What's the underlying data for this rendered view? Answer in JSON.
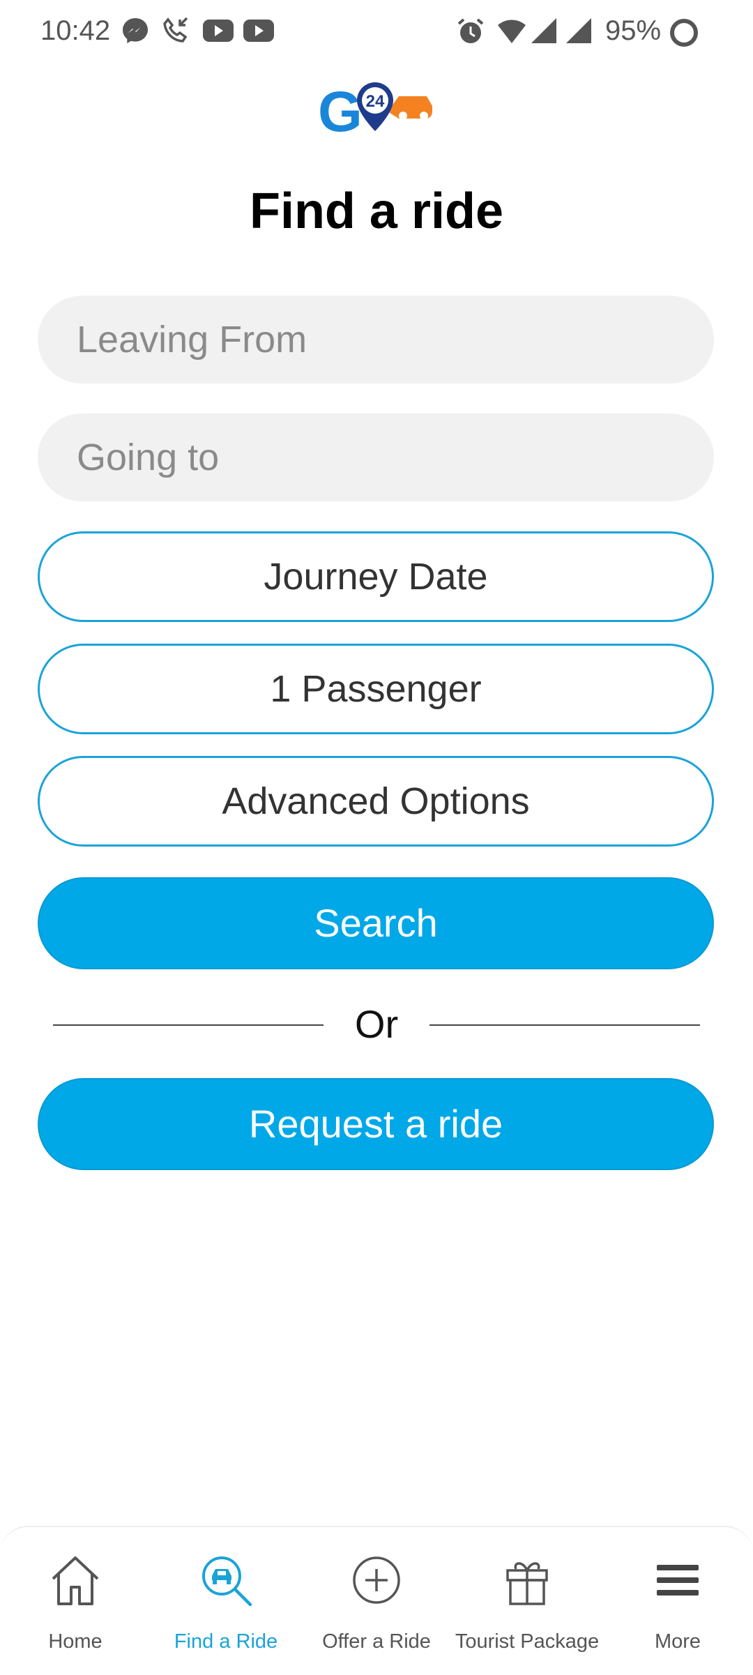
{
  "status_bar": {
    "time": "10:42",
    "left_icons": [
      "messenger-icon",
      "phone-call-icon",
      "youtube-icon",
      "youtube-icon"
    ],
    "right_icons": [
      "alarm-icon",
      "wifi-icon",
      "signal-icon",
      "signal-icon"
    ],
    "battery": "95%"
  },
  "header": {
    "logo_text": "G24",
    "title": "Find a ride"
  },
  "form": {
    "leaving_from_placeholder": "Leaving From",
    "going_to_placeholder": "Going to",
    "journey_date_label": "Journey Date",
    "passengers_label": "1 Passenger",
    "advanced_options_label": "Advanced Options",
    "search_label": "Search",
    "or_label": "Or",
    "request_label": "Request a ride"
  },
  "bottom_nav": {
    "items": [
      {
        "label": "Home",
        "icon": "home-icon"
      },
      {
        "label": "Find a Ride",
        "icon": "car-search-icon",
        "active": true
      },
      {
        "label": "Offer a Ride",
        "icon": "plus-circle-icon"
      },
      {
        "label": "Tourist Package",
        "icon": "gift-icon"
      },
      {
        "label": "More",
        "icon": "menu-icon"
      }
    ]
  },
  "colors": {
    "accent": "#00a8e8",
    "border": "#1aa3d9",
    "logo_blue": "#1a86d9",
    "logo_orange": "#f58220",
    "logo_navy": "#1f3c8c"
  }
}
